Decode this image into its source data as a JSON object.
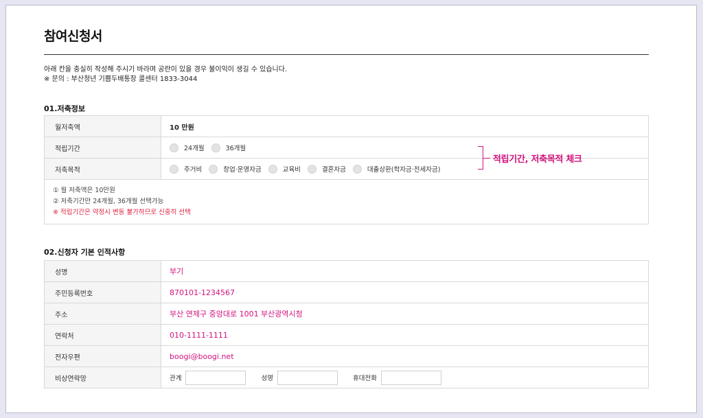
{
  "page": {
    "title": "참여신청서",
    "intro_line1": "아래 칸을 충실히 작성해 주시기 바라며 공란이 있을 경우 불이익이 생길 수 있습니다.",
    "intro_line2": "※ 문의 : 부산청년 기쁨두배통장 콜센터 1833-3044"
  },
  "savings": {
    "section_title": "01.저축정보",
    "monthly_label": "월저축액",
    "monthly_value": "10 만원",
    "period_label": "적립기간",
    "period_options": [
      "24개월",
      "36개월"
    ],
    "purpose_label": "저축목적",
    "purpose_options": [
      "주거비",
      "창업·운영자금",
      "교육비",
      "결혼자금",
      "대출상환(학자금·전세자금)"
    ],
    "notes": [
      "① 월 저축액은 10만원",
      "② 저축기간만 24개월, 36개월 선택가능",
      "※ 적립기간은 약정시 변동 불가하므로 신중히 선택"
    ]
  },
  "annotation": {
    "callout": "적립기간, 저축목적 체크"
  },
  "applicant": {
    "section_title": "02.신청자 기본 인적사항",
    "rows": [
      {
        "label": "성명",
        "value": "부기"
      },
      {
        "label": "주민등록번호",
        "value": "870101-1234567"
      },
      {
        "label": "주소",
        "value": "부산 연제구 중앙대로 1001 부산광역시청"
      },
      {
        "label": "연락처",
        "value": "010-1111-1111"
      },
      {
        "label": "전자우편",
        "value": "boogi@boogi.net"
      }
    ],
    "emergency_label": "비상연락망",
    "emergency_fields": {
      "relation_label": "관계",
      "name_label": "성명",
      "phone_label": "휴대전화"
    }
  },
  "colors": {
    "accent": "#d0117c",
    "warning": "#e02040",
    "background": "#e6e6f3"
  }
}
